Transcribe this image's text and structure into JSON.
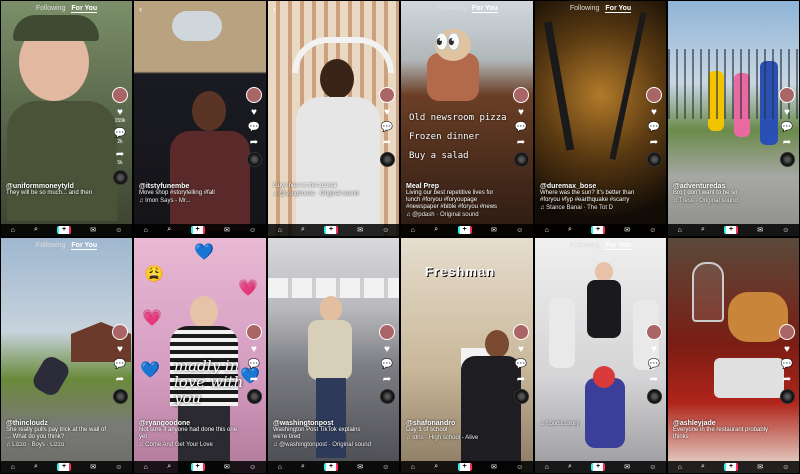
{
  "tabs": {
    "following": "Following",
    "for_you": "For You"
  },
  "nav_plus": "+",
  "tiles": [
    {
      "user": "@uniformmoneytyld",
      "caption": "They will be so much... and then",
      "sound": "",
      "top_tabs": true,
      "back": false,
      "likes": "159k",
      "comments": "2k",
      "shares": "5k",
      "bg": "#4b5540",
      "scene": "a"
    },
    {
      "user": "@itstyfunembe",
      "caption": "Move shop #storytelling #fall",
      "sound": "♫ Imon Says - Mr...",
      "top_tabs": false,
      "back": true,
      "likes": "",
      "comments": "",
      "shares": "",
      "bg": "#2a2223",
      "scene": "b"
    },
    {
      "user": "",
      "caption": "Guys here is the tutorial",
      "sound": "♫ @songhouse · Original sound",
      "top_tabs": false,
      "back": true,
      "likes": "",
      "comments": "",
      "shares": "",
      "bg": "#caa98a",
      "scene": "c"
    },
    {
      "user": "Meal Prep",
      "caption": "Living our best repetitive lives for lunch #foryou #foryoupage #newspaper #bible #foryou #news",
      "sound": "♫ @pdash · Original sound",
      "top_tabs": true,
      "back": false,
      "likes": "",
      "comments": "",
      "shares": "",
      "bg": "#6b4a2a",
      "scene": "d",
      "overlay": [
        "Old newsroom pizza",
        "Frozen dinner",
        "Buy a salad"
      ]
    },
    {
      "user": "@duremax_bose",
      "caption": "Where was the sun? It's better than #foryou #fyp #earthquake #scarry",
      "sound": "♫ Stance Banai · The Tot D",
      "top_tabs": true,
      "back": false,
      "likes": "",
      "comments": "",
      "shares": "",
      "bg": "#3a2a12",
      "scene": "e"
    },
    {
      "user": "@adventuredas",
      "caption": "Bro I don't want to be so",
      "sound": "♫ Tress · Original sound",
      "top_tabs": false,
      "back": false,
      "likes": "",
      "comments": "",
      "shares": "",
      "bg": "#7aa3c8",
      "scene": "f"
    },
    {
      "user": "@thincloudz",
      "caption": "She really pulls pay trick at the wall of ... What do you think?",
      "sound": "♫ Lizzo · Boys · Lizzo",
      "top_tabs": true,
      "back": false,
      "likes": "",
      "comments": "",
      "shares": "",
      "bg": "#7f9ab5",
      "scene": "g"
    },
    {
      "user": "@ryangoodone",
      "caption": "Not sure if anyone had done this one yet",
      "sound": "♫ Come And Get Your Love",
      "top_tabs": false,
      "back": false,
      "likes": "",
      "comments": "",
      "shares": "",
      "bg": "#d8a5c2",
      "scene": "h",
      "script": "madly in love with you"
    },
    {
      "user": "@washingtonpost",
      "caption": "Washington Post TikTok explains we're tired",
      "sound": "♫ @washingtonpost · Original sound",
      "top_tabs": false,
      "back": false,
      "likes": "",
      "comments": "",
      "shares": "",
      "bg": "#6e6f75",
      "scene": "i"
    },
    {
      "user": "@shafonandro",
      "caption": "Day 1 of school",
      "sound": "♫ Idris · High school - Alive",
      "top_tabs": false,
      "back": false,
      "likes": "",
      "comments": "",
      "shares": "",
      "bg": "#c9b89a",
      "scene": "j",
      "title": "Freshman"
    },
    {
      "user": "",
      "caption": "",
      "sound": "♫ Loud Luxury",
      "top_tabs": true,
      "back": false,
      "likes": "",
      "comments": "",
      "shares": "",
      "bg": "#d9d9dc",
      "scene": "k"
    },
    {
      "user": "@ashleyjade",
      "caption": "Everyone in the restaurant probably thinks",
      "sound": "",
      "top_tabs": false,
      "back": false,
      "likes": "",
      "comments": "",
      "shares": "",
      "bg": "#7a1d14",
      "scene": "l"
    }
  ],
  "colors": {
    "accent_red": "#fe2c55",
    "accent_cyan": "#25f4ee"
  }
}
